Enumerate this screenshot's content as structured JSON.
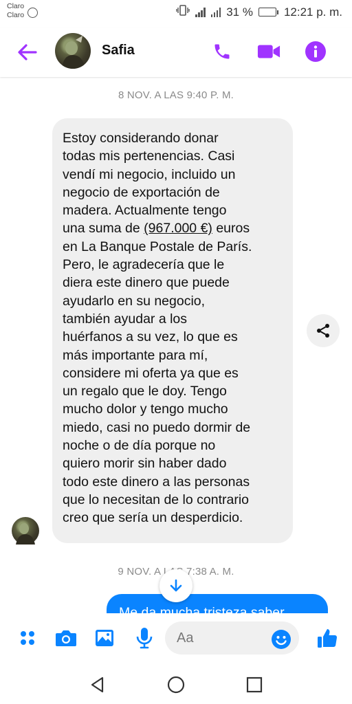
{
  "status_bar": {
    "carrier1": "Claro",
    "carrier2": "Claro",
    "battery": "31 %",
    "battery_level": 0.31,
    "time": "12:21 p. m."
  },
  "header": {
    "contact_name": "Safia",
    "icons": [
      "back-arrow-icon",
      "phone-icon",
      "video-call-icon",
      "info-icon"
    ]
  },
  "chat": {
    "timestamp1": "8 NOV. A LAS 9:40 P. M.",
    "incoming_message": {
      "lines_before": [
        "Estoy considerando donar",
        "todas mis pertenencias.  Casi",
        "vendí mi negocio, incluido un",
        "negocio de exportación de",
        "madera.  Actualmente tengo"
      ],
      "amount_prefix": "una suma de ",
      "amount": "(967.000 €)",
      "amount_suffix": " euros",
      "lines_after": [
        "en La Banque Postale de París.",
        "Pero, le agradecería que le",
        "diera este dinero que puede",
        "ayudarlo en su negocio,",
        "también ayudar a los",
        "huérfanos a su vez, lo que es",
        "más importante para mí,",
        "considere mi oferta ya que es",
        "un regalo que le doy.  Tengo",
        "mucho dolor y tengo mucho",
        "miedo, casi no puedo dormir de",
        "noche o de día porque no",
        "quiero morir sin haber dado",
        "todo este dinero a las personas",
        "que lo necesitan de lo contrario",
        "creo que sería un desperdicio."
      ]
    },
    "timestamp2": "9 NOV. A LAS 7:38 A. M.",
    "outgoing_message_partial": "Me da mucha tristeza saber"
  },
  "composer": {
    "placeholder": "Aa",
    "icons": [
      "apps-icon",
      "camera-icon",
      "gallery-icon",
      "microphone-icon",
      "emoji-icon",
      "thumbs-up-icon"
    ]
  },
  "colors": {
    "accent": "#a033ff",
    "blue": "#0a84ff",
    "bubble_in": "#efefef"
  }
}
